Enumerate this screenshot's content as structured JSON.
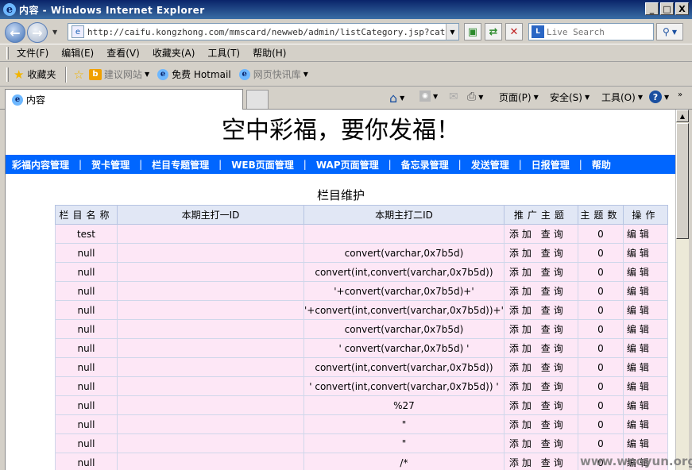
{
  "window": {
    "title": "内容 - Windows Internet Explorer",
    "minimize": "_",
    "maximize": "□",
    "close": "X"
  },
  "address": {
    "url": "http://caifu.kongzhong.com/mmscard/newweb/admin/listCategory.jsp?category=c",
    "search_placeholder": "Live Search"
  },
  "menu": [
    "文件(F)",
    "编辑(E)",
    "查看(V)",
    "收藏夹(A)",
    "工具(T)",
    "帮助(H)"
  ],
  "favorites": {
    "favorites_label": "收藏夹",
    "suggested_sites": "建议网站",
    "hotmail": "免费 Hotmail",
    "web_slice": "网页快讯库"
  },
  "tab": {
    "title": "内容"
  },
  "command_bar": {
    "page": "页面(P)",
    "safety": "安全(S)",
    "tools": "工具(O)"
  },
  "site": {
    "banner": "空中彩福，要你发福！",
    "nav": [
      "彩福内容管理",
      "贺卡管理",
      "栏目专题管理",
      "WEB页面管理",
      "WAP页面管理",
      "备忘录管理",
      "发送管理",
      "日报管理",
      "帮助"
    ],
    "nav_separator": "|"
  },
  "table": {
    "title": "栏目维护",
    "headers": [
      "栏目名称",
      "本期主打一ID",
      "本期主打二ID",
      "推广主题",
      "主题数",
      "操作"
    ],
    "op_add": "添加",
    "op_query": "查询",
    "op_edit": "编辑",
    "rows": [
      {
        "name": "test",
        "id1": "",
        "id2": "",
        "count": "0"
      },
      {
        "name": "null",
        "id1": "",
        "id2": "convert(varchar,0x7b5d)",
        "count": "0"
      },
      {
        "name": "null",
        "id1": "",
        "id2": "convert(int,convert(varchar,0x7b5d))",
        "count": "0"
      },
      {
        "name": "null",
        "id1": "",
        "id2": "'+convert(varchar,0x7b5d)+'",
        "count": "0"
      },
      {
        "name": "null",
        "id1": "",
        "id2": "'+convert(int,convert(varchar,0x7b5d))+'",
        "count": "0"
      },
      {
        "name": "null",
        "id1": "",
        "id2": "convert(varchar,0x7b5d)",
        "count": "0"
      },
      {
        "name": "null",
        "id1": "",
        "id2": "' convert(varchar,0x7b5d) '",
        "count": "0"
      },
      {
        "name": "null",
        "id1": "",
        "id2": "convert(int,convert(varchar,0x7b5d))",
        "count": "0"
      },
      {
        "name": "null",
        "id1": "",
        "id2": "' convert(int,convert(varchar,0x7b5d)) '",
        "count": "0"
      },
      {
        "name": "null",
        "id1": "",
        "id2": "%27",
        "count": "0"
      },
      {
        "name": "null",
        "id1": "",
        "id2": "\"",
        "count": "0"
      },
      {
        "name": "null",
        "id1": "",
        "id2": "\"",
        "count": "0"
      },
      {
        "name": "null",
        "id1": "",
        "id2": "/*",
        "count": "0"
      }
    ]
  },
  "watermark": "www.wooyun.org"
}
